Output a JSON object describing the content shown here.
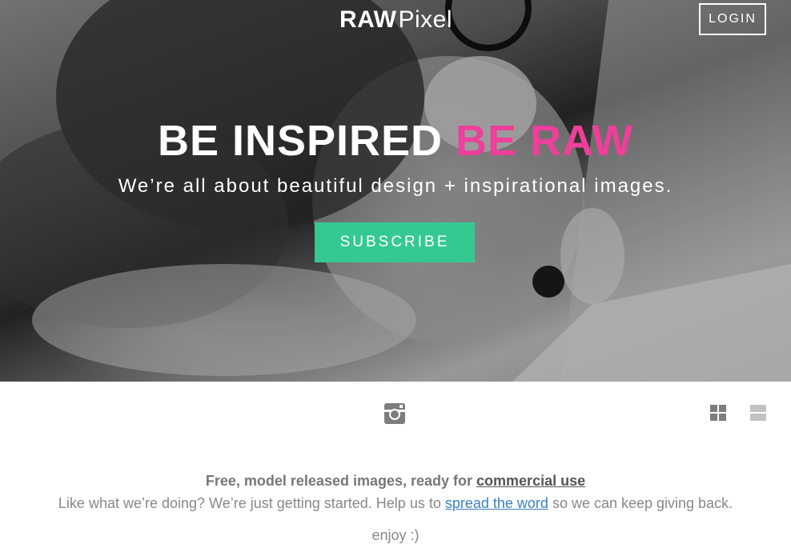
{
  "header": {
    "logo_raw": "RAW",
    "logo_pixel": "Pixel",
    "login_label": "LOGIN"
  },
  "hero": {
    "headline_part1": "BE INSPIRED",
    "headline_part2": "BE RAW",
    "subline": "We’re all about beautiful design + inspirational images.",
    "subscribe_label": "SUBSCRIBE",
    "accent_color": "#ee3f9b",
    "button_color": "#35c992"
  },
  "toolbar": {
    "social_icon": "instagram-icon",
    "grid_icon": "grid-view-icon",
    "list_icon": "list-view-icon"
  },
  "content": {
    "line1_text": "Free, model released images, ready for ",
    "line1_link": "commercial use",
    "line2_text_before": "Like what we’re doing? We’re just getting started. Help us to ",
    "line2_link": "spread the word",
    "line2_text_after": " so we can keep giving back.",
    "line3_text": "enjoy :)",
    "link_color": "#3a7fc1"
  }
}
